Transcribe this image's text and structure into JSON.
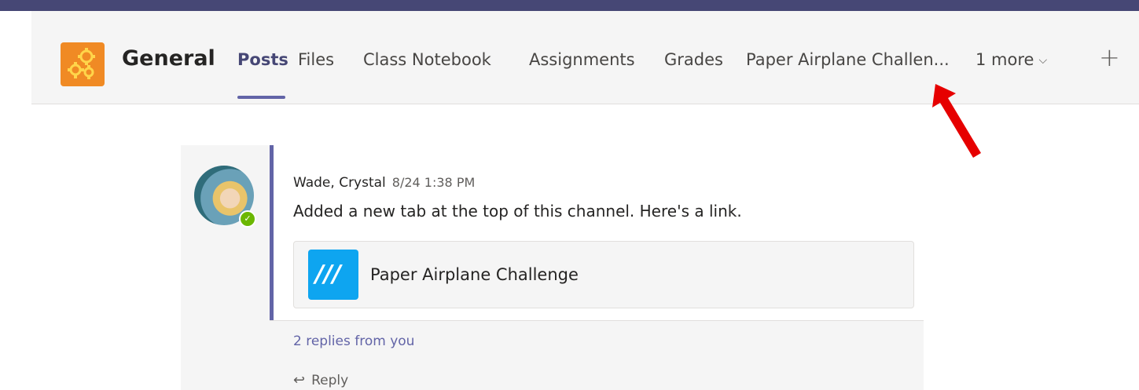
{
  "header": {
    "channel_name": "General",
    "tabs": [
      {
        "label": "Posts",
        "active": true
      },
      {
        "label": "Files"
      },
      {
        "label": "Class Notebook"
      },
      {
        "label": "Assignments"
      },
      {
        "label": "Grades"
      },
      {
        "label": "Paper Airplane Challen..."
      },
      {
        "label": "1 more"
      }
    ],
    "add_tab_symbol": "+",
    "team_icon": "gears-icon",
    "accent_color": "#464775"
  },
  "post": {
    "author": "Wade, Crystal",
    "timestamp": "8/24 1:38 PM",
    "message": "Added a new tab at the top of this channel. Here's a link.",
    "link_card_title": "Paper Airplane Challenge",
    "replies_summary": "2 replies from you",
    "reply_label": "Reply"
  },
  "annotation": {
    "arrow_color": "#e60000"
  }
}
